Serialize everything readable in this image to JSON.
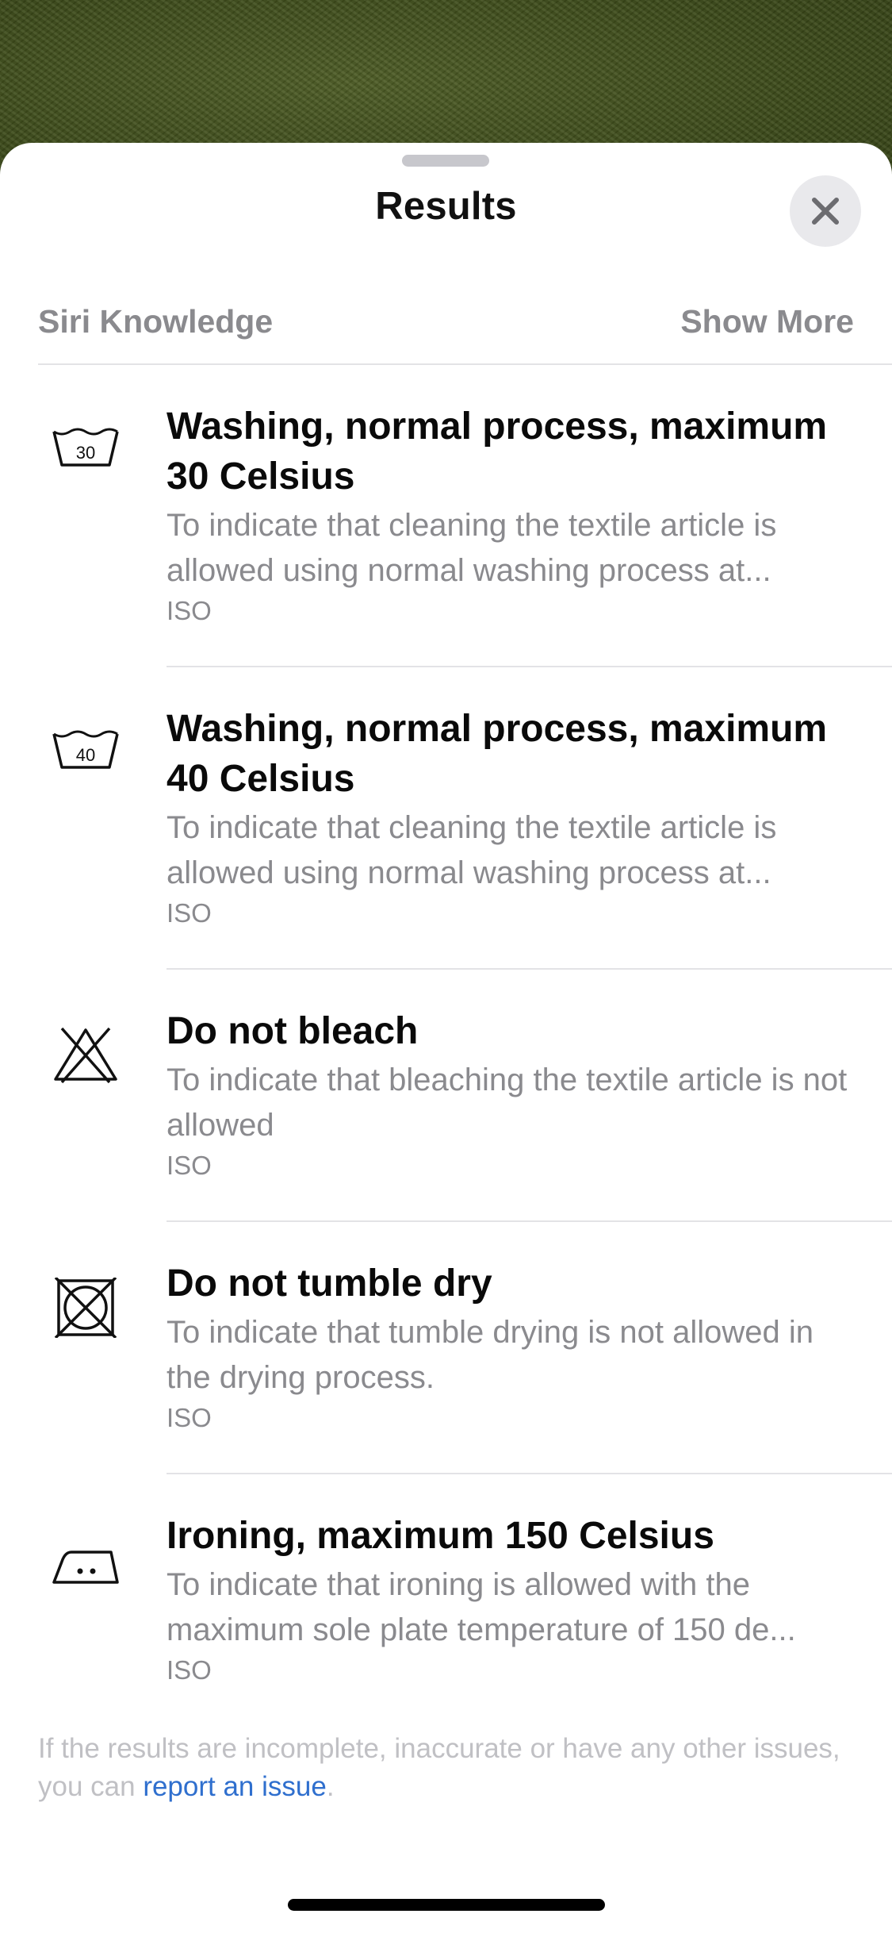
{
  "sheet": {
    "title": "Results",
    "close_icon": "close-icon"
  },
  "section": {
    "title": "Siri Knowledge",
    "show_more": "Show More"
  },
  "results": [
    {
      "icon": "wash-30-icon",
      "icon_text": "30",
      "title": "Washing, normal process, maximum 30 Celsius",
      "description": "To indicate that cleaning the textile article is allowed using normal washing process at...",
      "source": "ISO"
    },
    {
      "icon": "wash-40-icon",
      "icon_text": "40",
      "title": "Washing, normal process, maximum 40 Celsius",
      "description": "To indicate that cleaning the textile article is allowed using normal washing process at...",
      "source": "ISO"
    },
    {
      "icon": "do-not-bleach-icon",
      "title": "Do not bleach",
      "description": "To indicate that bleaching the textile article is not allowed",
      "source": "ISO"
    },
    {
      "icon": "do-not-tumble-dry-icon",
      "title": "Do not tumble dry",
      "description": "To indicate that tumble drying is not allowed in the drying process.",
      "source": "ISO"
    },
    {
      "icon": "iron-icon",
      "title": "Ironing, maximum 150 Celsius",
      "description": "To indicate that ironing is allowed with the maximum sole plate temperature of 150 de...",
      "source": "ISO"
    }
  ],
  "footer": {
    "text_before": "If the results are incomplete, inaccurate or have any other issues, you can ",
    "link": "report an issue",
    "text_after": "."
  },
  "colors": {
    "accent_link": "#2f6fce",
    "secondary_text": "#8a8a8e",
    "backdrop_fabric": "#3f4d1c"
  }
}
